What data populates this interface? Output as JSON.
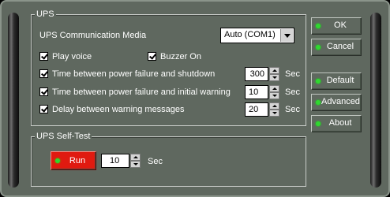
{
  "ups_group": {
    "title": "UPS",
    "comm_media_label": "UPS Communication Media",
    "comm_media_value": "Auto (COM1)",
    "play_voice_label": "Play voice",
    "play_voice_checked": true,
    "buzzer_label": "Buzzer On",
    "buzzer_checked": true,
    "rows": [
      {
        "label": "Time between power failure and shutdown",
        "value": "300",
        "unit": "Sec",
        "checked": true
      },
      {
        "label": "Time between power failure and initial warning",
        "value": "10",
        "unit": "Sec",
        "checked": true
      },
      {
        "label": "Delay between warning messages",
        "value": "20",
        "unit": "Sec",
        "checked": true
      }
    ]
  },
  "selftest_group": {
    "title": "UPS Self-Test",
    "run_label": "Run",
    "value": "10",
    "unit": "Sec"
  },
  "buttons": {
    "ok": "OK",
    "cancel": "Cancel",
    "default": "Default",
    "advanced": "Advanced",
    "about": "About"
  },
  "colors": {
    "panel": "#5f685f",
    "run_button": "#e01a10",
    "led": "#2fd82f"
  }
}
